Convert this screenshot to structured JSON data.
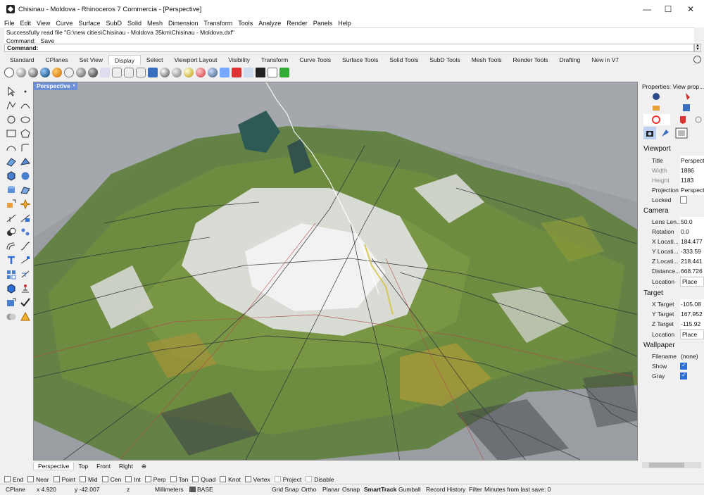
{
  "window": {
    "title": "Chisinau - Moldova - Rhinoceros 7 Commercia - [Perspective]",
    "minimize": "—",
    "maximize": "☐",
    "close": "✕"
  },
  "menu": [
    "File",
    "Edit",
    "View",
    "Curve",
    "Surface",
    "SubD",
    "Solid",
    "Mesh",
    "Dimension",
    "Transform",
    "Tools",
    "Analyze",
    "Render",
    "Panels",
    "Help"
  ],
  "command_history": [
    "Successfully read file \"G:\\new cities\\Chisinau - Moldova 35km\\Chisinau - Moldova.dxf\"",
    "Command: _Save"
  ],
  "command_prompt": "Command:",
  "tabs": [
    "Standard",
    "CPlanes",
    "Set View",
    "Display",
    "Select",
    "Viewport Layout",
    "Visibility",
    "Transform",
    "Curve Tools",
    "Surface Tools",
    "Solid Tools",
    "SubD Tools",
    "Mesh Tools",
    "Render Tools",
    "Drafting",
    "New in V7"
  ],
  "active_tab": "Display",
  "viewport": {
    "label": "Perspective",
    "menu_arrow": "▾"
  },
  "viewport_tabs": [
    "Perspective",
    "Top",
    "Front",
    "Right"
  ],
  "viewport_tabs_add": "⊕",
  "properties": {
    "title": "Properties: View prop...",
    "sections": {
      "viewport": {
        "heading": "Viewport",
        "title_label": "Title",
        "title_value": "Perspect",
        "width_label": "Width",
        "width_value": "1886",
        "height_label": "Height",
        "height_value": "1183",
        "projection_label": "Projection",
        "projection_value": "Perspect",
        "locked_label": "Locked",
        "locked": false
      },
      "camera": {
        "heading": "Camera",
        "lens_label": "Lens Len...",
        "lens_value": "50.0",
        "rotation_label": "Rotation",
        "rotation_value": "0.0",
        "x_label": "X Locati...",
        "x_value": "184.477",
        "y_label": "Y Locati...",
        "y_value": "-333.59",
        "z_label": "Z Locati...",
        "z_value": "218.441",
        "distance_label": "Distance...",
        "distance_value": "668.726",
        "location_label": "Location",
        "location_button": "Place"
      },
      "target": {
        "heading": "Target",
        "x_label": "X Target",
        "x_value": "-105.08",
        "y_label": "Y Target",
        "y_value": "167.952",
        "z_label": "Z Target",
        "z_value": "-115.92",
        "location_label": "Location",
        "location_button": "Place"
      },
      "wallpaper": {
        "heading": "Wallpaper",
        "filename_label": "Filename",
        "filename_value": "(none)",
        "show_label": "Show",
        "show": true,
        "gray_label": "Gray",
        "gray": true
      }
    }
  },
  "osnaps": [
    "End",
    "Near",
    "Point",
    "Mid",
    "Cen",
    "Int",
    "Perp",
    "Tan",
    "Quad",
    "Knot",
    "Vertex",
    "Project",
    "Disable"
  ],
  "status": {
    "cplane": "CPlane",
    "x": "x 4.920",
    "y": "y -42.007",
    "z": "z",
    "units": "Millimeters",
    "layer": "BASE",
    "grid_snap": "Grid Snap",
    "ortho": "Ortho",
    "planar": "Planar",
    "osnap": "Osnap",
    "smarttrack": "SmartTrack",
    "gumball": "Gumball",
    "record_history": "Record History",
    "filter": "Filter",
    "save_info": "Minutes from last save: 0"
  },
  "colors": {
    "viewport_bg": "#a4a8ad",
    "vegetation": "#4f7a2e",
    "roads": "#2f3236",
    "buildings": "#e7e7e7",
    "accent": "#6b8fd4"
  }
}
